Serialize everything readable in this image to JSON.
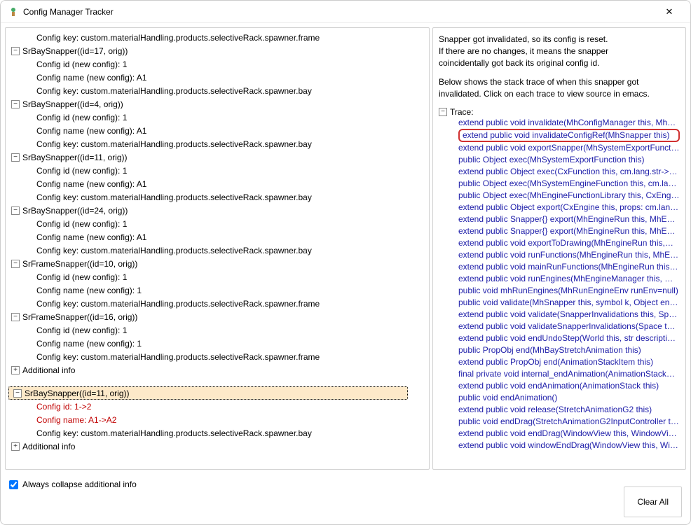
{
  "window": {
    "title": "Config Manager Tracker",
    "close_glyph": "✕"
  },
  "left_tree": [
    {
      "indent": 30,
      "toggle": null,
      "text": "Config key: custom.materialHandling.products.selectiveRack.spawner.frame"
    },
    {
      "indent": 4,
      "toggle": "-",
      "text": "SrBaySnapper((id=17, orig))"
    },
    {
      "indent": 30,
      "toggle": null,
      "text": "Config id (new config): 1"
    },
    {
      "indent": 30,
      "toggle": null,
      "text": "Config name (new config): A1"
    },
    {
      "indent": 30,
      "toggle": null,
      "text": "Config key: custom.materialHandling.products.selectiveRack.spawner.bay"
    },
    {
      "indent": 4,
      "toggle": "-",
      "text": "SrBaySnapper((id=4, orig))"
    },
    {
      "indent": 30,
      "toggle": null,
      "text": "Config id (new config): 1"
    },
    {
      "indent": 30,
      "toggle": null,
      "text": "Config name (new config): A1"
    },
    {
      "indent": 30,
      "toggle": null,
      "text": "Config key: custom.materialHandling.products.selectiveRack.spawner.bay"
    },
    {
      "indent": 4,
      "toggle": "-",
      "text": "SrBaySnapper((id=11, orig))"
    },
    {
      "indent": 30,
      "toggle": null,
      "text": "Config id (new config): 1"
    },
    {
      "indent": 30,
      "toggle": null,
      "text": "Config name (new config): A1"
    },
    {
      "indent": 30,
      "toggle": null,
      "text": "Config key: custom.materialHandling.products.selectiveRack.spawner.bay"
    },
    {
      "indent": 4,
      "toggle": "-",
      "text": "SrBaySnapper((id=24, orig))"
    },
    {
      "indent": 30,
      "toggle": null,
      "text": "Config id (new config): 1"
    },
    {
      "indent": 30,
      "toggle": null,
      "text": "Config name (new config): A1"
    },
    {
      "indent": 30,
      "toggle": null,
      "text": "Config key: custom.materialHandling.products.selectiveRack.spawner.bay"
    },
    {
      "indent": 4,
      "toggle": "-",
      "text": "SrFrameSnapper((id=10, orig))"
    },
    {
      "indent": 30,
      "toggle": null,
      "text": "Config id (new config): 1"
    },
    {
      "indent": 30,
      "toggle": null,
      "text": "Config name (new config): 1"
    },
    {
      "indent": 30,
      "toggle": null,
      "text": "Config key: custom.materialHandling.products.selectiveRack.spawner.frame"
    },
    {
      "indent": 4,
      "toggle": "-",
      "text": "SrFrameSnapper((id=16, orig))"
    },
    {
      "indent": 30,
      "toggle": null,
      "text": "Config id (new config): 1"
    },
    {
      "indent": 30,
      "toggle": null,
      "text": "Config name (new config): 1"
    },
    {
      "indent": 30,
      "toggle": null,
      "text": "Config key: custom.materialHandling.products.selectiveRack.spawner.frame"
    },
    {
      "indent": 4,
      "toggle": "+",
      "text": "Additional info"
    },
    {
      "spacer": 14
    },
    {
      "indent": 4,
      "toggle": "-",
      "selected": true,
      "text": "SrBaySnapper((id=11, orig))"
    },
    {
      "indent": 30,
      "toggle": null,
      "red": true,
      "text": "Config id: 1->2"
    },
    {
      "indent": 30,
      "toggle": null,
      "red": true,
      "text": "Config name: A1->A2"
    },
    {
      "indent": 30,
      "toggle": null,
      "text": "Config key: custom.materialHandling.products.selectiveRack.spawner.bay"
    },
    {
      "indent": 4,
      "toggle": "+",
      "text": "Additional info"
    }
  ],
  "right": {
    "paragraph1": "Snapper got invalidated, so its config is reset.\nIf there are no changes, it means the snapper\ncoincidentally got back its original config id.",
    "paragraph2": "Below shows the stack trace of when this snapper got\ninvalidated. Click on each trace to view source in emacs.",
    "trace_label": "Trace:",
    "traces": [
      {
        "text": "extend public void invalidate(MhConfigManager this, Mh…",
        "hl": false
      },
      {
        "text": "extend public void invalidateConfigRef(MhSnapper this)",
        "hl": true
      },
      {
        "text": "extend public void exportSnapper(MhSystemExportFuncti…"
      },
      {
        "text": "public Object exec(MhSystemExportFunction this)"
      },
      {
        "text": "extend public Object exec(CxFunction this, cm.lang.str->…"
      },
      {
        "text": "public Object exec(MhSystemEngineFunction this, cm.lan…"
      },
      {
        "text": "public Object exec(MhEngineFunctionLibrary this, CxEngi…"
      },
      {
        "text": "extend public Object export(CxEngine this, props: cm.lan…"
      },
      {
        "text": "extend public Snapper{} export(MhEngineRun this, MhEn…"
      },
      {
        "text": "extend public Snapper{} export(MhEngineRun this, MhEn…"
      },
      {
        "text": "extend public void exportToDrawing(MhEngineRun this,…"
      },
      {
        "text": "extend public void runFunctions(MhEngineRun this, MhE…"
      },
      {
        "text": "extend public void mainRunFunctions(MhEngineRun this,…"
      },
      {
        "text": "extend public void runEngines(MhEngineManager this, M…"
      },
      {
        "text": "public void mhRunEngines(MhRunEngineEnv runEnv=null)"
      },
      {
        "text": "public void validate(MhSnapper this, symbol k, Object en…"
      },
      {
        "text": "extend public void validate(SnapperInvalidations this, Sp…"
      },
      {
        "text": "extend public void validateSnapperInvalidations(Space this)"
      },
      {
        "text": "extend public void endUndoStep(World this, str descriptio…"
      },
      {
        "text": "public PropObj end(MhBayStretchAnimation this)"
      },
      {
        "text": "extend public PropObj end(AnimationStackItem this)"
      },
      {
        "text": "final private void internal_endAnimation(AnimationStack…"
      },
      {
        "text": "extend public void endAnimation(AnimationStack this)"
      },
      {
        "text": "public void endAnimation()"
      },
      {
        "text": "extend public void release(StretchAnimationG2 this)"
      },
      {
        "text": "public void endDrag(StretchAnimationG2InputController t…"
      },
      {
        "text": "extend public void endDrag(WindowView this, WindowVi…"
      },
      {
        "text": "extend public void windowEndDrag(WindowView this, Wi…"
      }
    ]
  },
  "footer": {
    "checkbox_label": "Always collapse additional info",
    "checkbox_checked": true,
    "clear_button": "Clear All"
  }
}
